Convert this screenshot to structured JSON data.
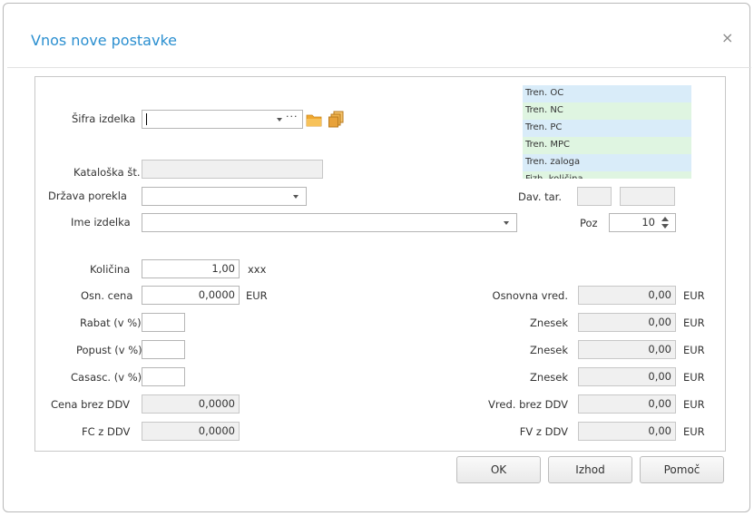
{
  "dialog": {
    "title": "Vnos nove postavke",
    "close_glyph": "×"
  },
  "fields": {
    "sifra_label": "Šifra izdelka",
    "sifra_value": "",
    "sifra_ellipsis": "···",
    "kataloska_label": "Kataloška št.",
    "drzava_label": "Država porekla",
    "ime_label": "Ime izdelka",
    "dav_tar_label": "Dav. tar.",
    "poz_label": "Poz",
    "poz_value": "10",
    "kolicina_label": "Količina",
    "kolicina_value": "1,00",
    "kolicina_unit": "xxx",
    "osn_cena_label": "Osn. cena",
    "osn_cena_value": "0,0000",
    "osn_cena_unit": "EUR",
    "rabat_label": "Rabat (v %)",
    "popust_label": "Popust (v %)",
    "casasc_label": "Casasc. (v %)",
    "cena_brez_label": "Cena brez DDV",
    "cena_brez_value": "0,0000",
    "fc_label": "FC z DDV",
    "fc_value": "0,0000"
  },
  "right_fields": [
    {
      "label": "Osnovna vred.",
      "value": "0,00",
      "unit": "EUR"
    },
    {
      "label": "Znesek",
      "value": "0,00",
      "unit": "EUR"
    },
    {
      "label": "Znesek",
      "value": "0,00",
      "unit": "EUR"
    },
    {
      "label": "Znesek",
      "value": "0,00",
      "unit": "EUR"
    },
    {
      "label": "Vred. brez DDV",
      "value": "0,00",
      "unit": "EUR"
    },
    {
      "label": "FV z DDV",
      "value": "0,00",
      "unit": "EUR"
    }
  ],
  "info_rows": [
    {
      "label": "Tren. OC",
      "tone": "blue"
    },
    {
      "label": "Tren. NC",
      "tone": "green"
    },
    {
      "label": "Tren. PC",
      "tone": "blue"
    },
    {
      "label": "Tren. MPC",
      "tone": "green"
    },
    {
      "label": "Tren. zaloga",
      "tone": "blue"
    },
    {
      "label": "Fizh. količina",
      "tone": "green"
    }
  ],
  "buttons": {
    "ok": "OK",
    "izhod": "Izhod",
    "pomoc": "Pomoč"
  },
  "colors": {
    "title": "#2b8fd0",
    "info_blue": "#d9ecf9",
    "info_green": "#dff5e1",
    "folder": "#f0a830",
    "copy": "#e8a23a"
  }
}
